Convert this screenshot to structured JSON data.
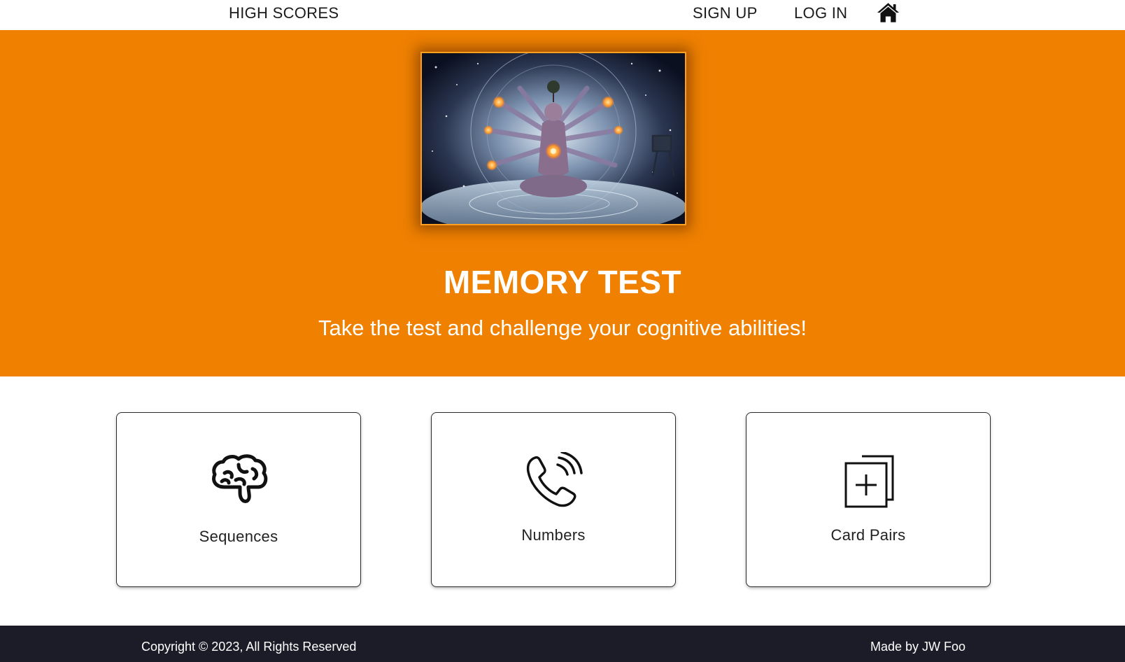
{
  "nav": {
    "high_scores": "HIGH SCORES",
    "sign_up": "SIGN UP",
    "log_in": "LOG IN",
    "home_icon": "home-icon"
  },
  "hero": {
    "background_color": "#ef8000",
    "image_description_icon": "cosmic-meditation-image",
    "title": "MEMORY TEST",
    "subtitle": "Take the test and challenge your cognitive abilities!"
  },
  "games": [
    {
      "label": "Sequences",
      "icon": "brain-icon"
    },
    {
      "label": "Numbers",
      "icon": "phone-ringing-icon"
    },
    {
      "label": "Card Pairs",
      "icon": "cards-plus-icon"
    }
  ],
  "footer": {
    "background_color": "#1b1c27",
    "copyright": "Copyright © 2023, All Rights Reserved",
    "made_by": "Made by JW Foo"
  }
}
